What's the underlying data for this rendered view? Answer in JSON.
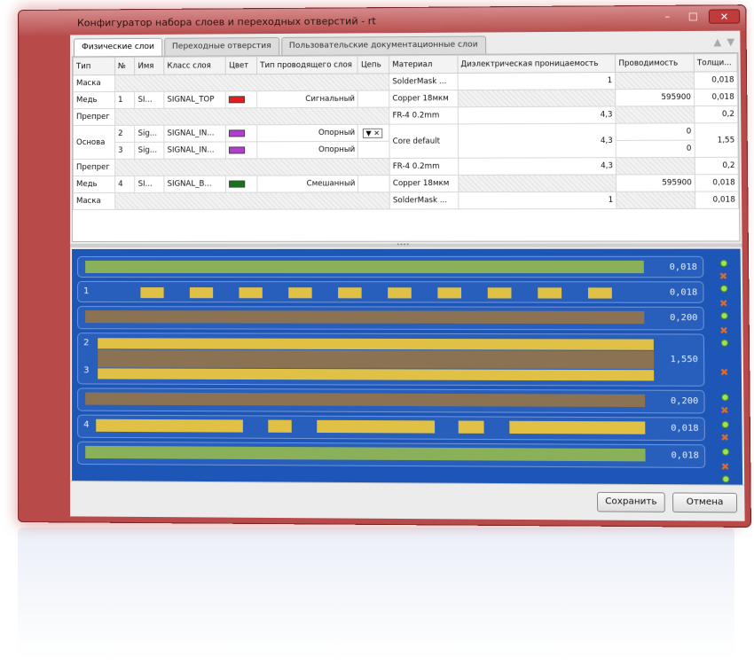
{
  "window": {
    "title": "Конфигуратор набора слоев и переходных отверстий - rt",
    "controls": {
      "minimize": "–",
      "maximize": "□",
      "close": "✕"
    }
  },
  "tabs": [
    "Физические слои",
    "Переходные отверстия",
    "Пользовательские документационные слои"
  ],
  "toolbar": {
    "up_icon": "▲",
    "down_icon": "▼"
  },
  "grid": {
    "headers": [
      "Тип",
      "№",
      "Имя",
      "Класс слоя",
      "Цвет",
      "Тип проводящего слоя",
      "Цепь",
      "Материал",
      "Диэлектрическая проницаемость",
      "Проводимость",
      "Толщи..."
    ],
    "rows": [
      {
        "type": "Маска",
        "num": "",
        "name": "",
        "class": "",
        "color": "",
        "cond_type": "",
        "net": "",
        "material": "SolderMask ...",
        "permittivity": "1",
        "conductivity": "",
        "thickness": "0,018"
      },
      {
        "type": "Медь",
        "num": "1",
        "name": "SI...",
        "class": "SIGNAL_TOP",
        "color": "#e31c1c",
        "cond_type": "Сигнальный",
        "net": "",
        "material": "Copper 18мкм",
        "permittivity": "",
        "conductivity": "595900",
        "thickness": "0,018"
      },
      {
        "type": "Препрег",
        "num": "",
        "name": "",
        "class": "",
        "color": "",
        "cond_type": "",
        "net": "",
        "material": "FR-4 0.2mm",
        "permittivity": "4,3",
        "conductivity": "",
        "thickness": "0,2"
      },
      {
        "type": "Основа",
        "num": "2",
        "name": "Sig...",
        "class": "SIGNAL_IN...",
        "color": "#b13cd6",
        "cond_type": "Опорный",
        "net": "",
        "material": "Core default",
        "permittivity": "4,3",
        "conductivity": "0",
        "thickness": "1,55"
      },
      {
        "type": "",
        "num": "3",
        "name": "Sig...",
        "class": "SIGNAL_IN...",
        "color": "#b13cd6",
        "cond_type": "Опорный",
        "net": "",
        "material": "",
        "permittivity": "",
        "conductivity": "0",
        "thickness": ""
      },
      {
        "type": "Препрег",
        "num": "",
        "name": "",
        "class": "",
        "color": "",
        "cond_type": "",
        "net": "",
        "material": "FR-4 0.2mm",
        "permittivity": "4,3",
        "conductivity": "",
        "thickness": "0,2"
      },
      {
        "type": "Медь",
        "num": "4",
        "name": "SI...",
        "class": "SIGNAL_B...",
        "color": "#13761b",
        "cond_type": "Смешанный",
        "net": "",
        "material": "Copper 18мкм",
        "permittivity": "",
        "conductivity": "595900",
        "thickness": "0,018"
      },
      {
        "type": "Маска",
        "num": "",
        "name": "",
        "class": "",
        "color": "",
        "cond_type": "",
        "net": "",
        "material": "SolderMask ...",
        "permittivity": "1",
        "conductivity": "",
        "thickness": "0,018"
      }
    ],
    "dropdown_arrow": "▼",
    "dropdown_clear": "✕"
  },
  "diagram": {
    "layers": [
      {
        "label": "",
        "value": "0,018",
        "kind": "mask"
      },
      {
        "label": "1",
        "value": "0,018",
        "kind": "copper"
      },
      {
        "label": "",
        "value": "0,200",
        "kind": "prepreg"
      },
      {
        "label": "2",
        "label2": "3",
        "value": "1,550",
        "kind": "core"
      },
      {
        "label": "",
        "value": "0,200",
        "kind": "prepreg"
      },
      {
        "label": "4",
        "value": "0,018",
        "kind": "copper"
      },
      {
        "label": "",
        "value": "0,018",
        "kind": "mask"
      }
    ],
    "colors": {
      "background": "#1d56b7",
      "mask": "#8ab05a",
      "copper": "#e0c145",
      "dielectric": "#8b7253"
    }
  },
  "footer": {
    "save": "Сохранить",
    "cancel": "Отмена"
  }
}
